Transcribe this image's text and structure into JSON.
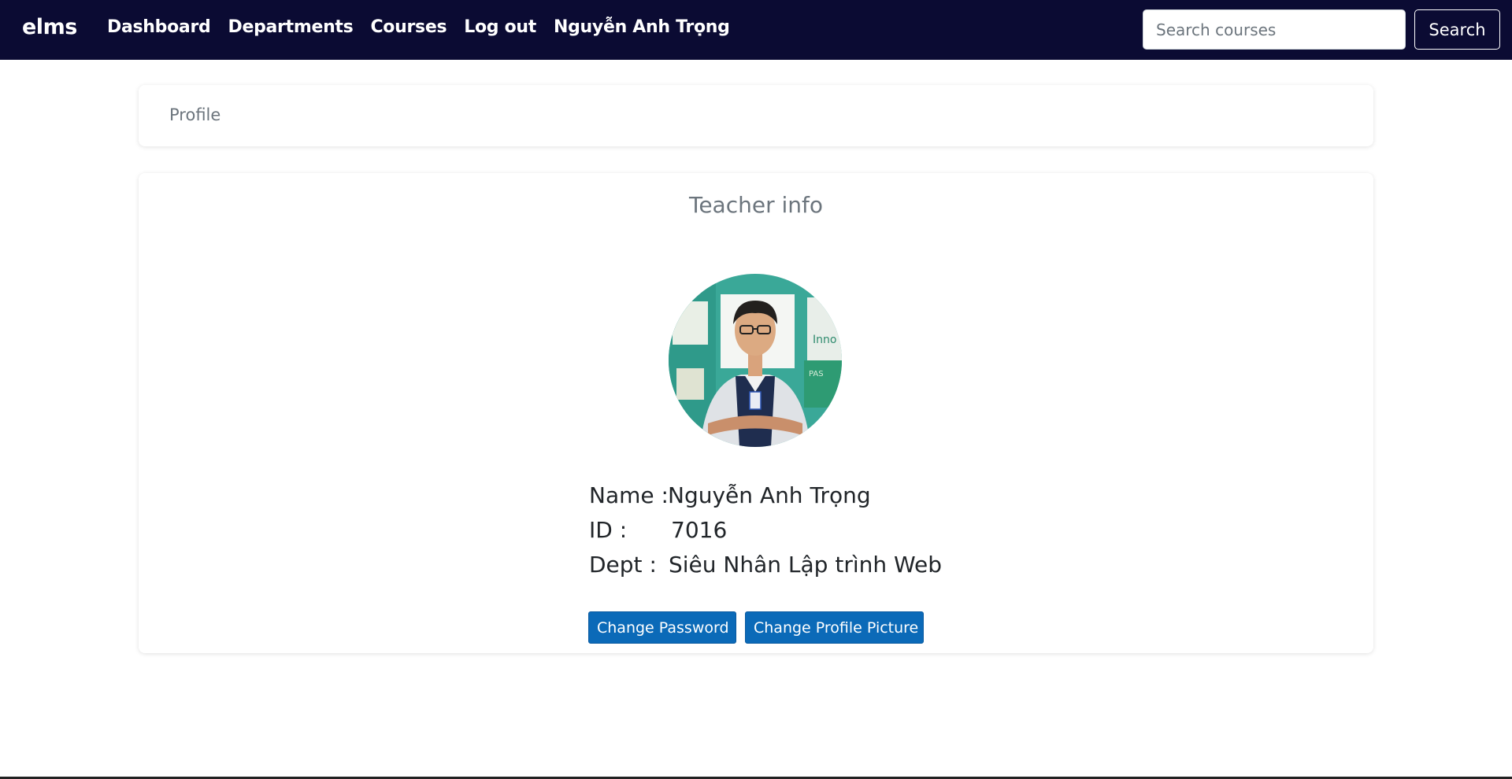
{
  "navbar": {
    "brand": "elms",
    "links": [
      {
        "label": "Dashboard"
      },
      {
        "label": "Departments"
      },
      {
        "label": "Courses"
      },
      {
        "label": "Log out"
      },
      {
        "label": "Nguyễn Anh Trọng"
      }
    ],
    "search": {
      "placeholder": "Search courses",
      "value": "",
      "button_label": "Search"
    }
  },
  "breadcrumb": {
    "label": "Profile"
  },
  "teacher": {
    "title": "Teacher info",
    "name_label": "Name :",
    "name": "Nguyễn Anh Trọng",
    "id_label": "ID :",
    "id": "7016",
    "dept_label": "Dept :",
    "dept": "Siêu Nhân Lập trình Web"
  },
  "actions": {
    "change_password": "Change Password",
    "change_picture": "Change Profile Picture"
  },
  "colors": {
    "navbar_bg": "#0b0b33",
    "primary_button": "#0b6ab8",
    "muted_text": "#6c757d"
  }
}
